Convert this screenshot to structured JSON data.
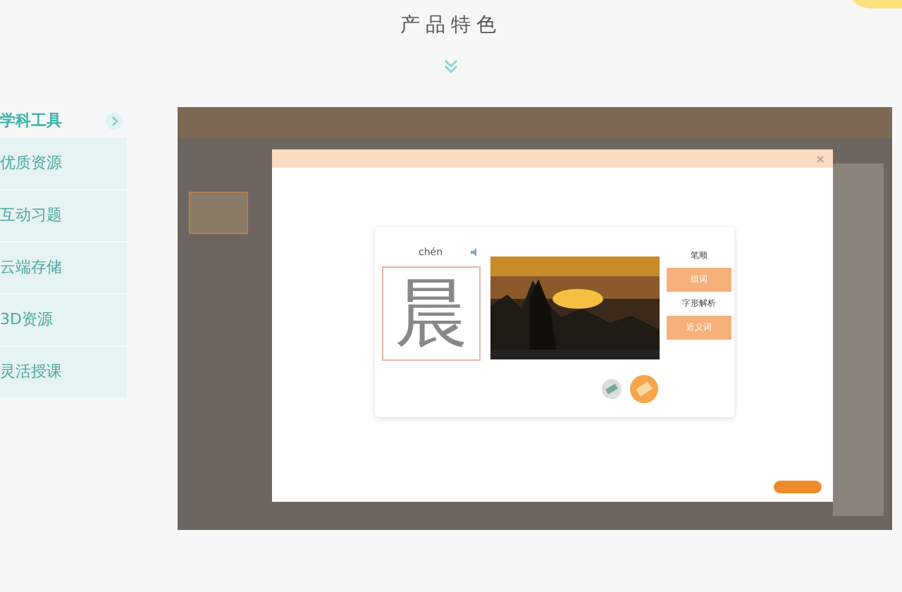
{
  "section_title": "产品特色",
  "sidebar": {
    "items": [
      {
        "label": "学科工具",
        "selected": true
      },
      {
        "label": "优质资源",
        "selected": false
      },
      {
        "label": "互动习题",
        "selected": false
      },
      {
        "label": "云端存储",
        "selected": false
      },
      {
        "label": "3D资源",
        "selected": false
      },
      {
        "label": "灵活授课",
        "selected": false
      }
    ]
  },
  "dialog": {
    "pinyin": "chén",
    "character": "晨",
    "menu": [
      {
        "label": "笔顺",
        "selected": false
      },
      {
        "label": "组词",
        "selected": true
      },
      {
        "label": "字形解析",
        "selected": false
      },
      {
        "label": "近义词",
        "selected": true
      }
    ]
  }
}
